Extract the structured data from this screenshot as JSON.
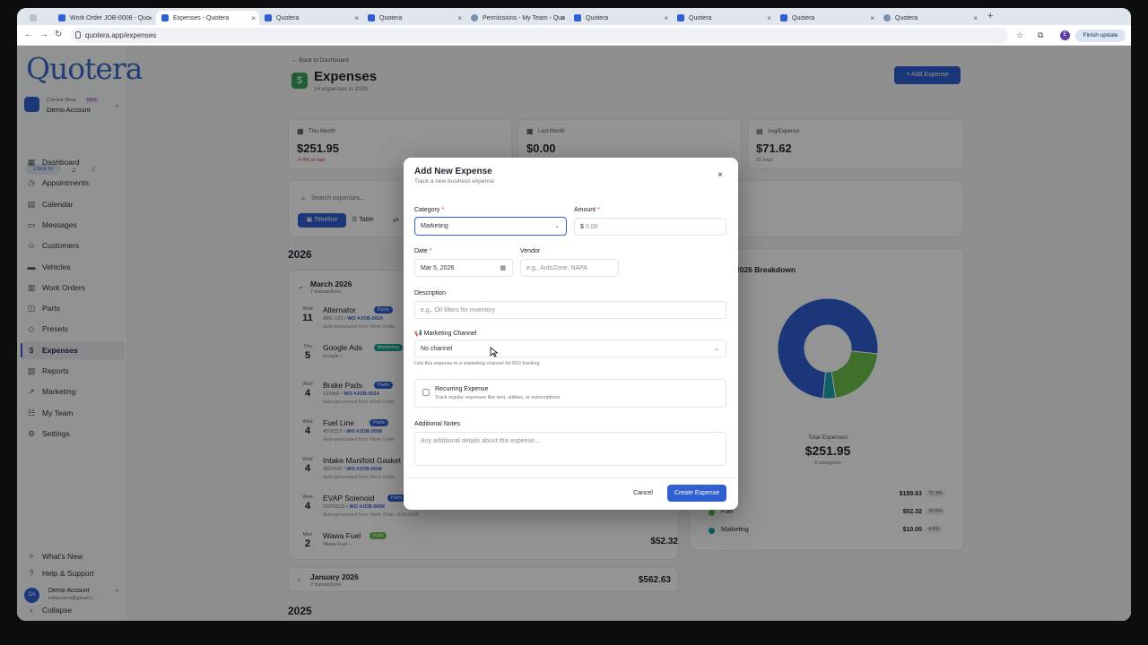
{
  "browser": {
    "tabs": [
      {
        "title": ""
      },
      {
        "title": "Work Order JOB-0008 - Quo"
      },
      {
        "title": "Expenses - Quotera"
      },
      {
        "title": "Quotera"
      },
      {
        "title": "Quotera"
      },
      {
        "title": "Permissions - My Team - Quo"
      },
      {
        "title": "Quotera"
      },
      {
        "title": "Quotera"
      },
      {
        "title": "Quotera"
      },
      {
        "title": "Quotera"
      }
    ],
    "url": "quotera.app/expenses",
    "profile_initial": "E",
    "finish_update": "Finish update"
  },
  "sidebar": {
    "logo": "Quotera",
    "current_shop_label": "Current Shop",
    "plan_badge": "MAX",
    "shop_name": "Demo Account",
    "clock_in": "Clock In",
    "items": [
      {
        "label": "Dashboard",
        "icon": "dashboard-icon"
      },
      {
        "label": "Appointments",
        "icon": "appointments-icon"
      },
      {
        "label": "Calendar",
        "icon": "calendar-icon"
      },
      {
        "label": "Messages",
        "icon": "messages-icon"
      },
      {
        "label": "Customers",
        "icon": "customers-icon"
      },
      {
        "label": "Vehicles",
        "icon": "vehicles-icon"
      },
      {
        "label": "Work Orders",
        "icon": "work-orders-icon"
      },
      {
        "label": "Parts",
        "icon": "parts-icon"
      },
      {
        "label": "Presets",
        "icon": "presets-icon"
      },
      {
        "label": "Expenses",
        "icon": "dollar-icon"
      },
      {
        "label": "Reports",
        "icon": "reports-icon"
      },
      {
        "label": "Marketing",
        "icon": "marketing-icon"
      },
      {
        "label": "My Team",
        "icon": "team-icon"
      },
      {
        "label": "Settings",
        "icon": "settings-icon"
      }
    ],
    "whats_new": "What's New",
    "help": "Help & Support",
    "user_initials": "DA",
    "user_name": "Demo Account",
    "user_email": "rellquotera@gmail.c...",
    "collapse": "Collapse"
  },
  "page": {
    "back": "← Back to Dashboard",
    "title": "Expenses",
    "subtitle": "14 expenses in 2026",
    "add_button": "Add Expense",
    "stats": [
      {
        "label": "This Month",
        "value": "$251.95",
        "sub": "↗ 0% vs last"
      },
      {
        "label": "Last Month",
        "value": "$0.00",
        "sub": ""
      },
      {
        "label": "Avg/Expense",
        "value": "$71.62",
        "sub": "21 total"
      }
    ],
    "search_placeholder": "Search expenses...",
    "view_timeline": "Timeline",
    "view_table": "Table",
    "year_2026": "2026",
    "year_2025": "2025",
    "march_label": "March 2026",
    "march_sub": "7 transactions",
    "january_label": "January 2026",
    "january_sub": "7 transactions",
    "january_total": "$562.63",
    "transactions": [
      {
        "dow": "Wed",
        "day": "11",
        "title": "Alternator",
        "tag": "Parts",
        "tag_color": "#2f5fd0",
        "meta": "ABC-123",
        "wo": "WO #JOB-0014",
        "note": "Auto-generated from Work Order",
        "amount": ""
      },
      {
        "dow": "Thu",
        "day": "5",
        "title": "Google Ads",
        "tag": "Marketing",
        "tag_color": "#1aa39a",
        "meta": "Google",
        "wo": "",
        "note": "",
        "amount": ""
      },
      {
        "dow": "Wed",
        "day": "4",
        "title": "Brake Pads",
        "tag": "Parts",
        "tag_color": "#2f5fd0",
        "meta": "123456",
        "wo": "WO #JOB-0014",
        "note": "Auto-generated from Work Order",
        "amount": ""
      },
      {
        "dow": "Wed",
        "day": "4",
        "title": "Fuel Line",
        "tag": "Parts",
        "tag_color": "#2f5fd0",
        "meta": "4578213",
        "wo": "WO #JOB-0008",
        "note": "Auto-generated from Work Order",
        "amount": ""
      },
      {
        "dow": "Wed",
        "day": "4",
        "title": "Intake Manifold Gasket",
        "tag": "",
        "tag_color": "",
        "meta": "4597632",
        "wo": "WO #JOB-0008",
        "note": "Auto-generated from Work Order",
        "amount": ""
      },
      {
        "dow": "Wed",
        "day": "4",
        "title": "EVAP Solenoid",
        "tag": "Parts",
        "tag_color": "#2f5fd0",
        "meta": "15976532",
        "wo": "WO #JOB-0008",
        "note": "Auto-generated from Work Order JOB-0008",
        "amount": ""
      },
      {
        "dow": "Mon",
        "day": "2",
        "title": "Wawa Fuel",
        "tag": "Fuel",
        "tag_color": "#6cc04a",
        "meta": "Wawa Fuel",
        "wo": "",
        "note": "",
        "amount": "$52.32"
      }
    ],
    "breakdown_title": "2026 Breakdown",
    "total_label": "Total Expenses",
    "total_value": "$251.95",
    "total_sub": "3 categories",
    "breakdown": [
      {
        "name": "",
        "amount": "$189.63",
        "pct": "75.3%",
        "color": "#2f5fd0"
      },
      {
        "name": "Fuel",
        "amount": "$52.32",
        "pct": "20.8%",
        "color": "#6cc04a"
      },
      {
        "name": "Marketing",
        "amount": "$10.00",
        "pct": "4.0%",
        "color": "#1aa3b0"
      }
    ]
  },
  "modal": {
    "title": "Add New Expense",
    "subtitle": "Track a new business expense",
    "category_label": "Category",
    "category_value": "Marketing",
    "amount_label": "Amount",
    "amount_prefix": "$",
    "amount_placeholder": "0.00",
    "date_label": "Date",
    "date_value": "Mar 5, 2026",
    "vendor_label": "Vendor",
    "vendor_placeholder": "e.g., AutoZone, NAPA",
    "description_label": "Description",
    "description_placeholder": "e.g., Oil filters for inventory",
    "channel_label": "Marketing Channel",
    "channel_value": "No channel",
    "channel_help": "Link this expense to a marketing channel for ROI tracking",
    "recurring_title": "Recurring Expense",
    "recurring_desc": "Track regular expenses like rent, utilities, or subscriptions",
    "notes_label": "Additional Notes",
    "notes_placeholder": "Any additional details about this expense...",
    "cancel": "Cancel",
    "create": "Create Expense"
  }
}
